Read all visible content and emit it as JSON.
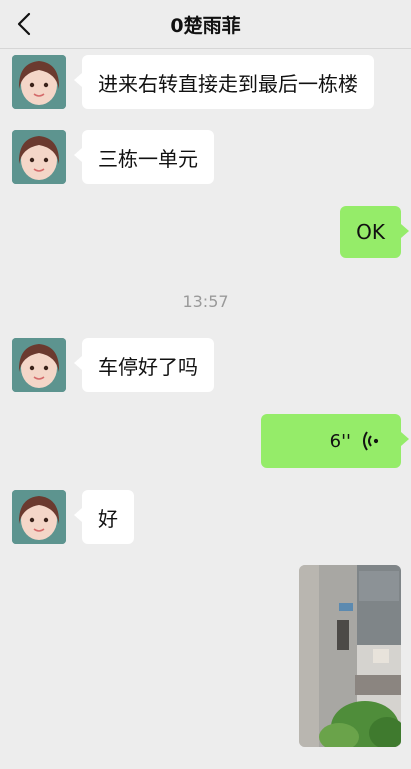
{
  "header": {
    "title": "0楚雨菲",
    "back_icon": "chevron-left-icon"
  },
  "messages": [
    {
      "side": "in",
      "text": "进来右转直接走到最后一栋楼"
    },
    {
      "side": "in",
      "text": "三栋一单元"
    },
    {
      "side": "out",
      "text": "OK"
    },
    {
      "type": "timestamp",
      "text": "13:57"
    },
    {
      "side": "in",
      "text": "车停好了吗"
    },
    {
      "side": "out",
      "type": "voice",
      "duration": "6''",
      "icon": "voice-wave-icon"
    },
    {
      "side": "in",
      "text": "好"
    },
    {
      "side": "out",
      "type": "image",
      "icon": "photo-thumbnail"
    }
  ],
  "colors": {
    "background": "#ededed",
    "incoming": "#ffffff",
    "outgoing": "#95ec69",
    "timestamp": "#9a9a9a"
  }
}
